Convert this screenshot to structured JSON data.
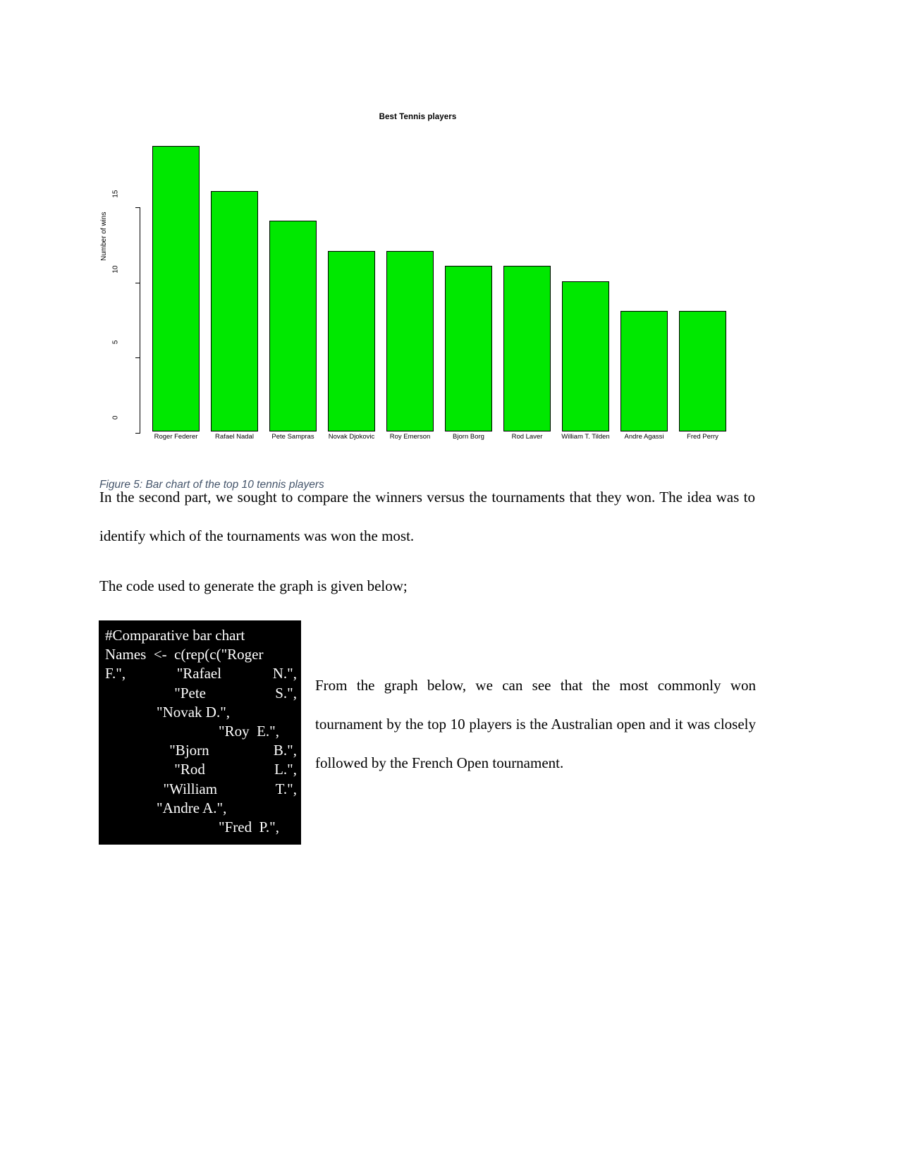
{
  "chart_data": {
    "type": "bar",
    "title": "Best Tennis players",
    "xlabel": "",
    "ylabel": "Number of wins",
    "categories": [
      "Roger Federer",
      "Rafael Nadal",
      "Pete Sampras",
      "Novak Djokovic",
      "Roy Emerson",
      "Bjorn Borg",
      "Rod Laver",
      "William T. Tilden",
      "Andre Agassi",
      "Fred Perry"
    ],
    "values": [
      19,
      16,
      14,
      12,
      12,
      11,
      11,
      10,
      8,
      8
    ],
    "ylim": [
      0,
      19.5
    ],
    "yticks": [
      0,
      5,
      10,
      15
    ],
    "ytick_labels": [
      "0",
      "5",
      "10",
      "15"
    ],
    "grid": false,
    "legend": false,
    "bar_color": "#00e800",
    "bar_border_color": "#000000"
  },
  "figure": {
    "caption": "Figure 5: Bar chart of the top 10 tennis players",
    "caption_color": "#44546a"
  },
  "body": {
    "paragraph_1": "In the second part, we sought to compare the winners versus the tournaments that they won. The idea was to identify which of the tournaments was won the most.",
    "paragraph_2": "The code used to generate the graph is given below;",
    "paragraph_3": "From the graph below, we can see that the most commonly won tournament by the top 10 players is the Australian open and it was closely followed by the French Open tournament."
  },
  "code_block": {
    "background": "#000000",
    "foreground": "#ffffff",
    "lines": [
      {
        "text": "#Comparative bar chart",
        "style": "plain"
      },
      {
        "text": "Names  <-  c(rep(c(\"Roger",
        "style": "plain"
      },
      {
        "left": "F.\",",
        "mid": "\"Rafael",
        "right": "N.\",",
        "style": "justify"
      },
      {
        "left": "",
        "mid": "\"Pete",
        "right": "S.\",",
        "style": "justify"
      },
      {
        "text": "\"Novak D.\",",
        "style": "indent"
      },
      {
        "text": "\"Roy  E.\",",
        "style": "indent2"
      },
      {
        "left": "",
        "mid": "\"Bjorn",
        "right": "B.\",",
        "style": "justify"
      },
      {
        "left": "",
        "mid": "\"Rod",
        "right": "L.\",",
        "style": "justify"
      },
      {
        "left": "",
        "mid": "\"William",
        "right": "T.\",",
        "style": "justify"
      },
      {
        "text": "\"Andre A.\",",
        "style": "indent"
      },
      {
        "text": "\"Fred  P.\",",
        "style": "indent2"
      }
    ]
  }
}
